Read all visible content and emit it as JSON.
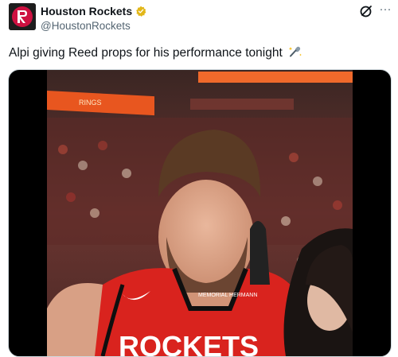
{
  "account": {
    "display_name": "Houston Rockets",
    "handle": "@HoustonRockets",
    "verified": true,
    "avatar_icon": "rockets-logo-icon"
  },
  "tweet": {
    "text": "Alpi giving Reed props for his performance tonight",
    "emoji_icon": "microphone-sparkle-icon"
  },
  "header_actions": {
    "grok_icon": "grok-icon",
    "more_label": "···"
  },
  "media": {
    "type": "video",
    "jersey_text": "ROCKETS",
    "jersey_number_hint": "",
    "jersey_patch_text": "MEMORIAL HERMANN",
    "scoreboard_text": "RINGS"
  },
  "colors": {
    "brand_red": "#ce1141",
    "verified_gold": "#e2b719",
    "text_secondary": "#536471"
  }
}
